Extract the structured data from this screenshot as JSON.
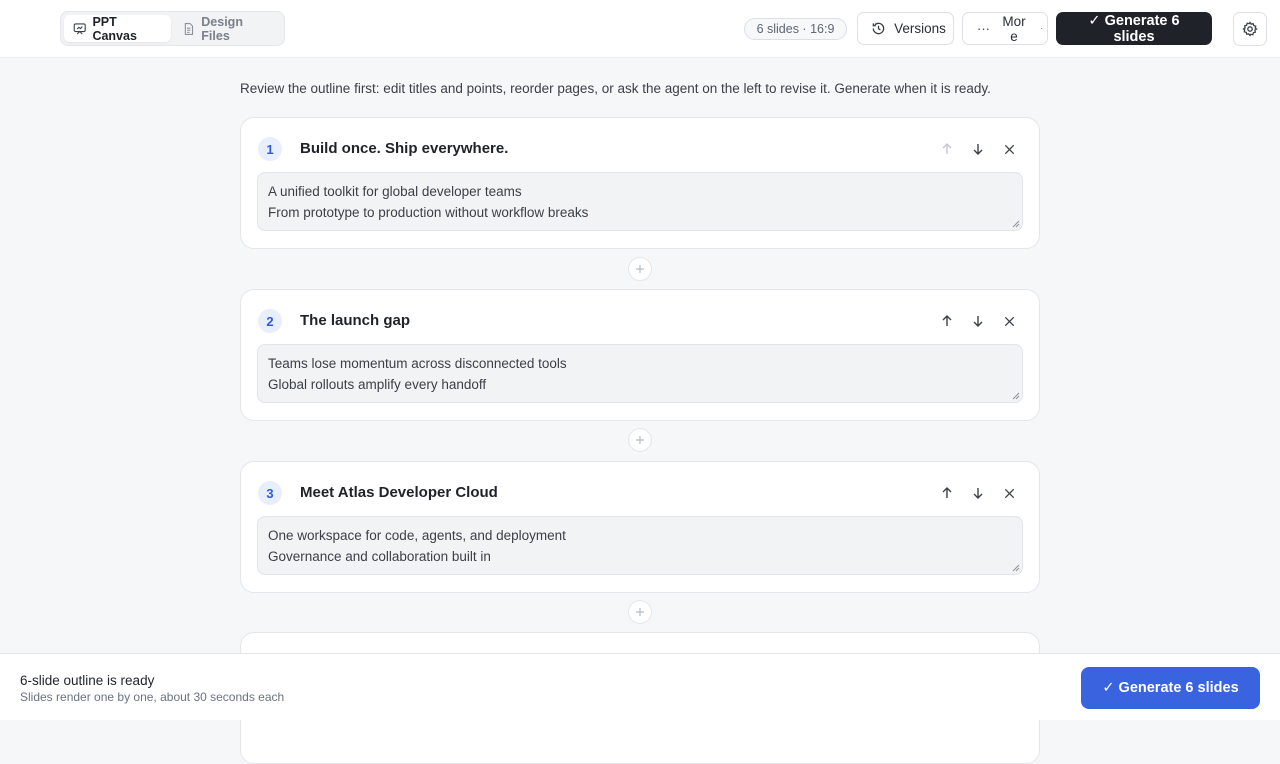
{
  "tabs": [
    {
      "label": "PPT Canvas",
      "icon": "presentation-icon",
      "active": true
    },
    {
      "label": "Design Files",
      "icon": "file-icon",
      "active": false
    }
  ],
  "header": {
    "slide_info": "6 slides · 16:9",
    "versions_label": "Versions",
    "more_label": "More",
    "generate_label": "✓ Generate 6 slides"
  },
  "intro": "Review the outline first: edit titles and points, reorder pages, or ask the agent on the left to revise it. Generate when it is ready.",
  "slides": [
    {
      "number": "1",
      "title": "Build once. Ship everywhere.",
      "points": [
        "A unified toolkit for global developer teams",
        "From prototype to production without workflow breaks"
      ]
    },
    {
      "number": "2",
      "title": "The launch gap",
      "points": [
        "Teams lose momentum across disconnected tools",
        "Global rollouts amplify every handoff"
      ]
    },
    {
      "number": "3",
      "title": "Meet Atlas Developer Cloud",
      "points": [
        "One workspace for code, agents, and deployment",
        "Governance and collaboration built in"
      ]
    }
  ],
  "footer": {
    "status": "6-slide outline is ready",
    "hint": "Slides render one by one, about 30 seconds each",
    "generate_label": "✓ Generate 6 slides"
  },
  "colors": {
    "accent": "#3a63e0",
    "dark": "#1f2329",
    "badge_bg": "#e8eefc"
  }
}
